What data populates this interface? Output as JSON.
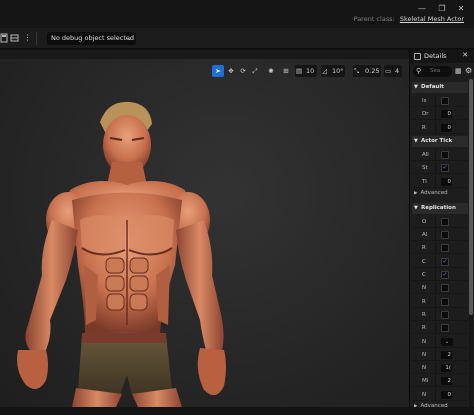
{
  "titlebar": {
    "parent_class_label": "Parent class:",
    "parent_class_value": "Skeletal Mesh Actor",
    "buttons": [
      "minimize",
      "restore",
      "close"
    ]
  },
  "toolbar": {
    "debug_object": "No debug object selected",
    "icons": [
      "save-icon",
      "browse-icon",
      "more-options-icon"
    ]
  },
  "viewport": {
    "tools": {
      "select": "select-icon",
      "translate": "translate-icon",
      "rotate": "rotate-icon",
      "scale": "scale-icon",
      "surface_snap": "surface-snap-icon",
      "grid_snap_value": "10",
      "rotation_snap_value": "10°",
      "scale_snap_value": "0.25",
      "camera_speed_value": "4"
    },
    "subject": "muscular male character model in shorts"
  },
  "details": {
    "title": "Details",
    "search_placeholder": "Sea",
    "sections": [
      {
        "name": "Default",
        "rows": [
          {
            "label": "Is",
            "type": "checkbox",
            "checked": false
          },
          {
            "label": "Dr",
            "type": "number",
            "value": "0"
          },
          {
            "label": "R",
            "type": "number",
            "value": "0"
          }
        ]
      },
      {
        "name": "Actor Tick",
        "rows": [
          {
            "label": "All",
            "type": "checkbox",
            "checked": false
          },
          {
            "label": "St",
            "type": "checkbox",
            "checked": true
          },
          {
            "label": "Ti",
            "type": "number",
            "value": "0"
          }
        ],
        "advanced": "Advanced"
      },
      {
        "name": "Replication",
        "rows": [
          {
            "label": "O",
            "type": "checkbox",
            "checked": false
          },
          {
            "label": "Al",
            "type": "checkbox",
            "checked": false
          },
          {
            "label": "R",
            "type": "checkbox",
            "checked": false
          },
          {
            "label": "C",
            "type": "checkbox",
            "checked": true
          },
          {
            "label": "C",
            "type": "checkbox",
            "checked": true
          },
          {
            "label": "N",
            "type": "checkbox",
            "checked": false
          },
          {
            "label": "R",
            "type": "checkbox",
            "checked": false
          },
          {
            "label": "R",
            "type": "checkbox",
            "checked": false
          },
          {
            "label": "R",
            "type": "checkbox",
            "checked": false
          },
          {
            "label": "N",
            "type": "dropdown",
            "value": "⌄"
          },
          {
            "label": "N",
            "type": "number",
            "value": "2"
          },
          {
            "label": "N",
            "type": "number",
            "value": "1("
          },
          {
            "label": "Mi",
            "type": "number",
            "value": "2"
          },
          {
            "label": "N",
            "type": "number",
            "value": "0"
          }
        ],
        "advanced": "Advanced"
      }
    ]
  },
  "colors": {
    "accent": "#1f6fd6",
    "check": "#3d8fff",
    "panel": "#1d1d1d",
    "viewport_bg": "#2b2b2b"
  }
}
